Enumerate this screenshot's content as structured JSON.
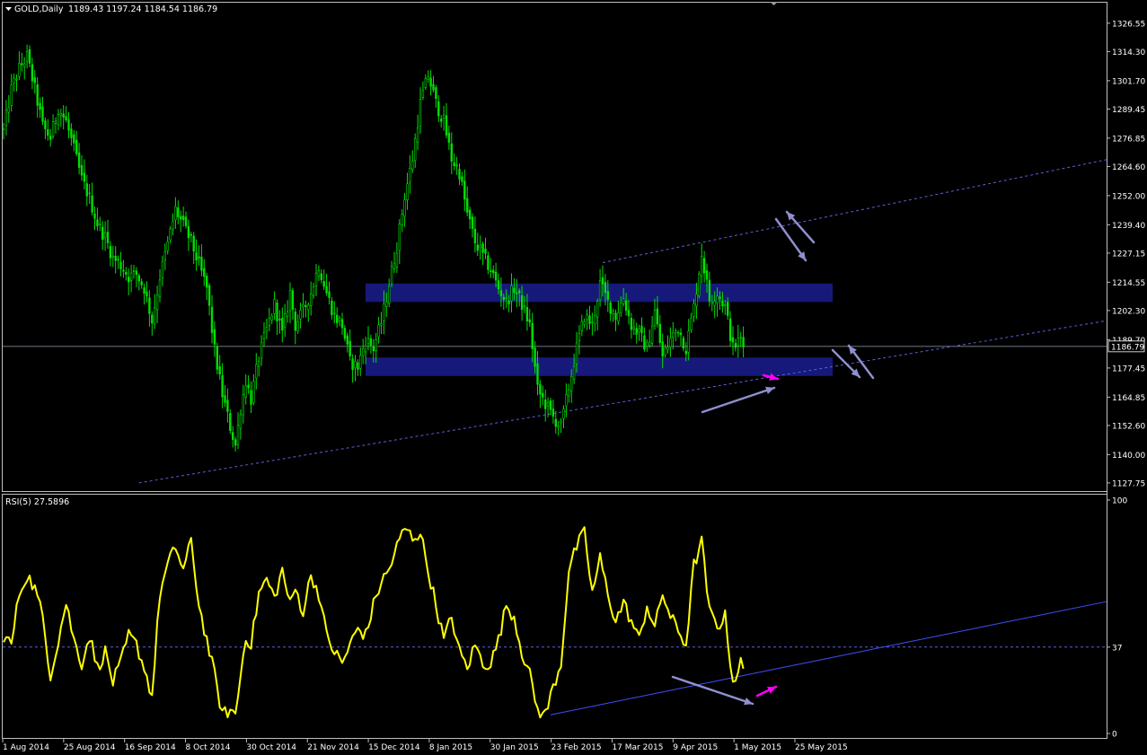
{
  "chart_data": [
    {
      "type": "candlestick",
      "header_symbol": "GOLD,Daily",
      "header_ohlc": "1189.43 1197.24 1184.54 1186.79",
      "y_ticks": [
        "1326.55",
        "1314.30",
        "1301.70",
        "1289.45",
        "1276.85",
        "1264.60",
        "1252.00",
        "1239.40",
        "1227.15",
        "1214.55",
        "1202.30",
        "1189.70",
        "1177.45",
        "1164.85",
        "1152.60",
        "1140.00",
        "1127.75"
      ],
      "ylim": [
        1125,
        1330
      ],
      "current_price_label": "1186.79",
      "current_price": 1186.79,
      "start_label": "1 Aug 2014",
      "approx_closes": [
        [
          0,
          1280
        ],
        [
          3,
          1298
        ],
        [
          6,
          1307
        ],
        [
          9,
          1312
        ],
        [
          12,
          1298
        ],
        [
          15,
          1282
        ],
        [
          18,
          1277
        ],
        [
          21,
          1290
        ],
        [
          24,
          1284
        ],
        [
          27,
          1272
        ],
        [
          30,
          1259
        ],
        [
          33,
          1251
        ],
        [
          36,
          1240
        ],
        [
          39,
          1234
        ],
        [
          42,
          1225
        ],
        [
          45,
          1222
        ],
        [
          48,
          1217
        ],
        [
          51,
          1218
        ],
        [
          54,
          1212
        ],
        [
          57,
          1198
        ],
        [
          60,
          1217
        ],
        [
          63,
          1231
        ],
        [
          66,
          1246
        ],
        [
          69,
          1239
        ],
        [
          72,
          1232
        ],
        [
          75,
          1222
        ],
        [
          78,
          1212
        ],
        [
          81,
          1185
        ],
        [
          84,
          1166
        ],
        [
          87,
          1152
        ],
        [
          89,
          1144
        ],
        [
          91,
          1160
        ],
        [
          93,
          1172
        ],
        [
          95,
          1164
        ],
        [
          98,
          1182
        ],
        [
          101,
          1194
        ],
        [
          104,
          1205
        ],
        [
          107,
          1192
        ],
        [
          110,
          1210
        ],
        [
          112,
          1196
        ],
        [
          115,
          1202
        ],
        [
          118,
          1210
        ],
        [
          121,
          1222
        ],
        [
          124,
          1210
        ],
        [
          127,
          1200
        ],
        [
          130,
          1196
        ],
        [
          133,
          1180
        ],
        [
          136,
          1178
        ],
        [
          139,
          1190
        ],
        [
          142,
          1186
        ],
        [
          145,
          1197
        ],
        [
          148,
          1214
        ],
        [
          151,
          1230
        ],
        [
          154,
          1252
        ],
        [
          157,
          1268
        ],
        [
          160,
          1292
        ],
        [
          163,
          1304
        ],
        [
          166,
          1292
        ],
        [
          169,
          1284
        ],
        [
          172,
          1268
        ],
        [
          175,
          1262
        ],
        [
          178,
          1244
        ],
        [
          181,
          1232
        ],
        [
          184,
          1226
        ],
        [
          187,
          1220
        ],
        [
          190,
          1212
        ],
        [
          193,
          1206
        ],
        [
          196,
          1212
        ],
        [
          199,
          1205
        ],
        [
          202,
          1196
        ],
        [
          205,
          1168
        ],
        [
          208,
          1162
        ],
        [
          211,
          1156
        ],
        [
          214,
          1152
        ],
        [
          217,
          1169
        ],
        [
          220,
          1186
        ],
        [
          223,
          1200
        ],
        [
          226,
          1196
        ],
        [
          229,
          1214
        ],
        [
          232,
          1206
        ],
        [
          235,
          1200
        ],
        [
          238,
          1208
        ],
        [
          241,
          1196
        ],
        [
          244,
          1192
        ],
        [
          247,
          1186
        ],
        [
          250,
          1202
        ],
        [
          253,
          1182
        ],
        [
          256,
          1190
        ],
        [
          259,
          1195
        ],
        [
          262,
          1186
        ],
        [
          265,
          1204
        ],
        [
          268,
          1227
        ],
        [
          271,
          1207
        ],
        [
          274,
          1210
        ],
        [
          277,
          1204
        ],
        [
          280,
          1186
        ],
        [
          283,
          1190
        ],
        [
          284,
          1186.79
        ]
      ],
      "drawings": {
        "resistance_zone": [
          1206,
          1214
        ],
        "support_zone": [
          1174,
          1182
        ],
        "horizontal_line": 1186.79,
        "lower_channel_line": [
          [
            52,
            1127.75
          ],
          [
            408,
            1195
          ]
        ],
        "upper_channel_line": [
          [
            230,
            1223
          ],
          [
            408,
            1264
          ]
        ]
      }
    },
    {
      "type": "line",
      "title": "RSI(5) 27.5896",
      "y_ticks": [
        "100",
        "37",
        "0"
      ],
      "ylim": [
        0,
        100
      ],
      "level": 37,
      "x_labels": [
        "1 Aug 2014",
        "25 Aug 2014",
        "16 Sep 2014",
        "8 Oct 2014",
        "30 Oct 2014",
        "21 Nov 2014",
        "15 Dec 2014",
        "8 Jan 2015",
        "30 Jan 2015",
        "23 Feb 2015",
        "17 Mar 2015",
        "9 Apr 2015",
        "1 May 2015",
        "25 May 2015"
      ],
      "approx_values": [
        [
          0,
          42
        ],
        [
          3,
          38
        ],
        [
          6,
          60
        ],
        [
          9,
          68
        ],
        [
          12,
          62
        ],
        [
          15,
          50
        ],
        [
          18,
          25
        ],
        [
          21,
          40
        ],
        [
          24,
          56
        ],
        [
          27,
          40
        ],
        [
          30,
          30
        ],
        [
          33,
          42
        ],
        [
          36,
          28
        ],
        [
          39,
          35
        ],
        [
          42,
          22
        ],
        [
          45,
          30
        ],
        [
          48,
          42
        ],
        [
          51,
          38
        ],
        [
          54,
          28
        ],
        [
          57,
          16
        ],
        [
          60,
          60
        ],
        [
          63,
          72
        ],
        [
          66,
          80
        ],
        [
          69,
          70
        ],
        [
          72,
          82
        ],
        [
          75,
          55
        ],
        [
          78,
          40
        ],
        [
          81,
          25
        ],
        [
          84,
          8
        ],
        [
          87,
          10
        ],
        [
          89,
          8
        ],
        [
          91,
          25
        ],
        [
          93,
          42
        ],
        [
          95,
          38
        ],
        [
          98,
          60
        ],
        [
          101,
          66
        ],
        [
          104,
          58
        ],
        [
          107,
          70
        ],
        [
          110,
          55
        ],
        [
          112,
          62
        ],
        [
          115,
          52
        ],
        [
          118,
          68
        ],
        [
          121,
          60
        ],
        [
          124,
          42
        ],
        [
          127,
          35
        ],
        [
          130,
          30
        ],
        [
          133,
          38
        ],
        [
          136,
          45
        ],
        [
          139,
          42
        ],
        [
          142,
          55
        ],
        [
          145,
          65
        ],
        [
          148,
          70
        ],
        [
          151,
          80
        ],
        [
          154,
          88
        ],
        [
          157,
          84
        ],
        [
          160,
          86
        ],
        [
          163,
          70
        ],
        [
          166,
          55
        ],
        [
          169,
          40
        ],
        [
          172,
          50
        ],
        [
          175,
          35
        ],
        [
          178,
          28
        ],
        [
          181,
          38
        ],
        [
          184,
          30
        ],
        [
          187,
          30
        ],
        [
          190,
          40
        ],
        [
          193,
          55
        ],
        [
          196,
          50
        ],
        [
          199,
          35
        ],
        [
          202,
          25
        ],
        [
          205,
          10
        ],
        [
          208,
          8
        ],
        [
          211,
          20
        ],
        [
          214,
          30
        ],
        [
          217,
          70
        ],
        [
          220,
          80
        ],
        [
          223,
          86
        ],
        [
          226,
          60
        ],
        [
          229,
          75
        ],
        [
          232,
          60
        ],
        [
          235,
          48
        ],
        [
          238,
          56
        ],
        [
          241,
          48
        ],
        [
          244,
          40
        ],
        [
          247,
          55
        ],
        [
          250,
          45
        ],
        [
          253,
          60
        ],
        [
          256,
          50
        ],
        [
          259,
          44
        ],
        [
          262,
          38
        ],
        [
          265,
          72
        ],
        [
          268,
          82
        ],
        [
          271,
          52
        ],
        [
          274,
          46
        ],
        [
          277,
          50
        ],
        [
          280,
          22
        ],
        [
          283,
          30
        ],
        [
          284,
          27.59
        ]
      ],
      "trend_line": [
        [
          210,
          8
        ],
        [
          408,
          53
        ]
      ]
    }
  ]
}
